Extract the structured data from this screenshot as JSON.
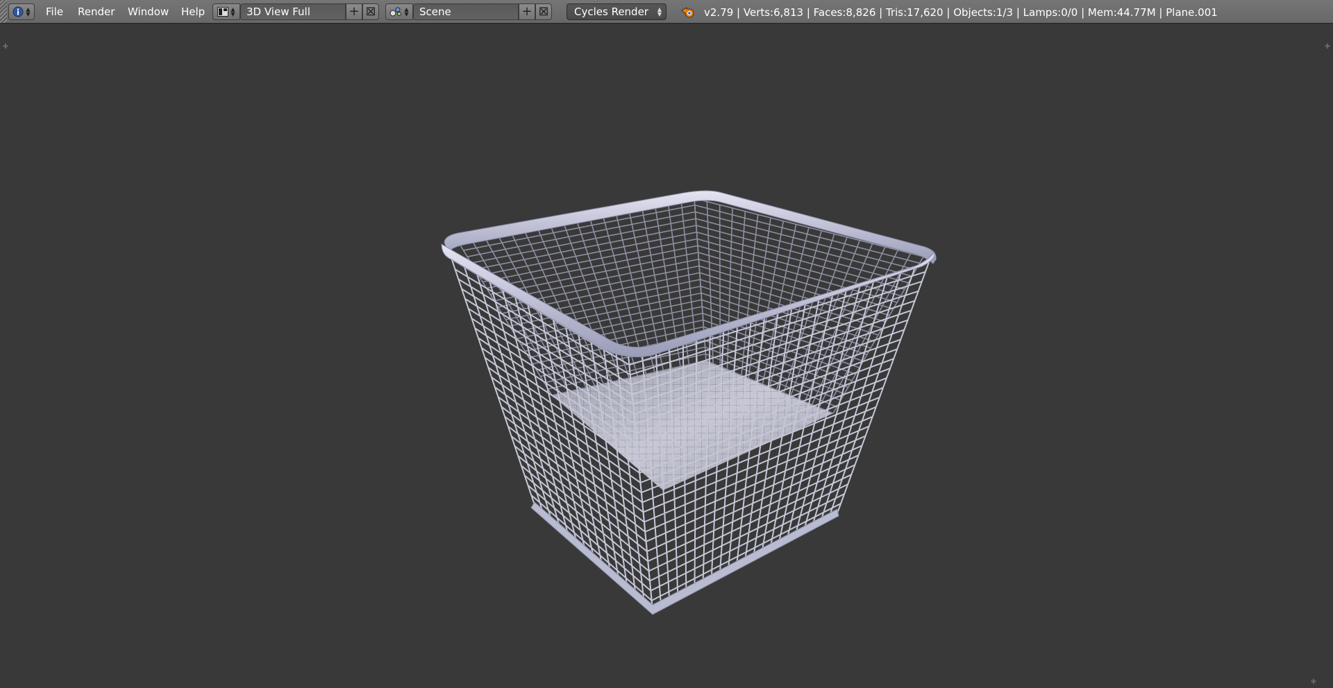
{
  "menubar": {
    "info_icon": "info-icon",
    "menus": [
      "File",
      "Render",
      "Window",
      "Help"
    ],
    "screen_layout": "3D View Full",
    "scene": "Scene",
    "render_engine": "Cycles Render",
    "stats": "v2.79 | Verts:6,813 | Faces:8,826 | Tris:17,620 | Objects:1/3 | Lamps:0/0 | Mem:44.77M | Plane.001"
  },
  "viewport": {
    "object": "wire-basket",
    "background_color": "#393939"
  }
}
